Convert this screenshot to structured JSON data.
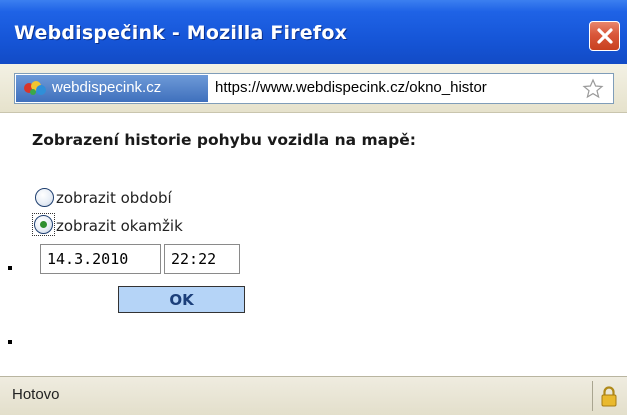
{
  "window": {
    "title": "Webdispečink - Mozilla Firefox",
    "close_icon": "close-icon"
  },
  "location_bar": {
    "site_name": "webdispecink.cz",
    "url": "https://www.webdispecink.cz/okno_histor",
    "bookmark_icon": "star-icon"
  },
  "content": {
    "heading": "Zobrazení historie pohybu vozidla na mapě:",
    "options": [
      {
        "label": "zobrazit období",
        "selected": false
      },
      {
        "label": "zobrazit okamžik",
        "selected": true
      }
    ],
    "date_value": "14.3.2010",
    "time_value": "22:22",
    "ok_label": "OK"
  },
  "status_bar": {
    "text": "Hotovo",
    "lock_icon": "padlock-icon"
  },
  "colors": {
    "titlebar": "#1656d8",
    "close_button": "#d9573a",
    "ok_button": "#b5d4f7",
    "site_badge": "#3f70bd"
  }
}
